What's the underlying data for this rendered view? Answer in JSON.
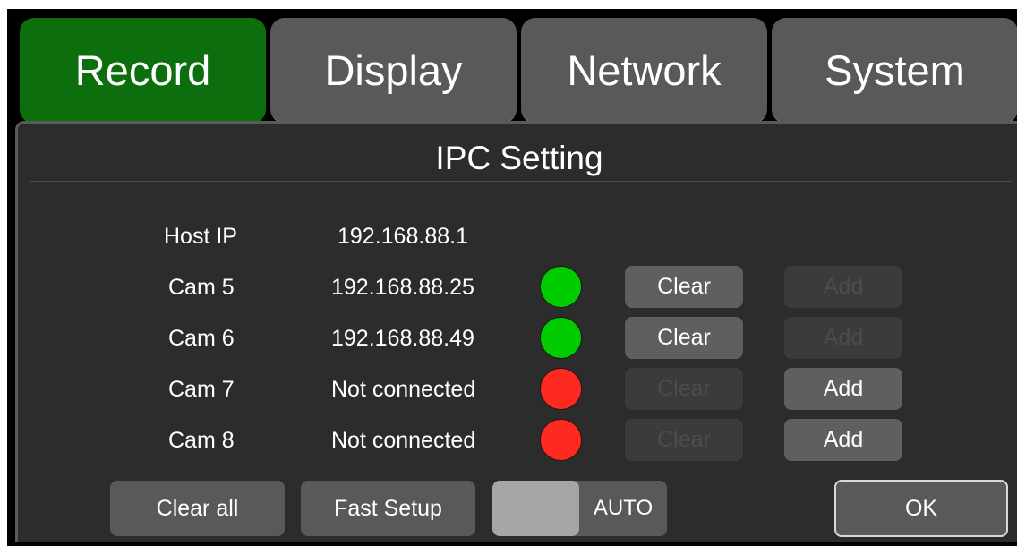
{
  "tabs": [
    {
      "label": "Record",
      "active": true
    },
    {
      "label": "Display",
      "active": false
    },
    {
      "label": "Network",
      "active": false
    },
    {
      "label": "System",
      "active": false
    }
  ],
  "panel": {
    "title": "IPC Setting"
  },
  "host": {
    "label": "Host IP",
    "ip": "192.168.88.1"
  },
  "cameras": [
    {
      "name": "Cam 5",
      "ip": "192.168.88.25",
      "status": "connected",
      "clear": "Clear",
      "add": "Add",
      "clear_enabled": true,
      "add_enabled": false
    },
    {
      "name": "Cam 6",
      "ip": "192.168.88.49",
      "status": "connected",
      "clear": "Clear",
      "add": "Add",
      "clear_enabled": true,
      "add_enabled": false
    },
    {
      "name": "Cam 7",
      "ip": "Not connected",
      "status": "disconnected",
      "clear": "Clear",
      "add": "Add",
      "clear_enabled": false,
      "add_enabled": true
    },
    {
      "name": "Cam 8",
      "ip": "Not connected",
      "status": "disconnected",
      "clear": "Clear",
      "add": "Add",
      "clear_enabled": false,
      "add_enabled": true
    }
  ],
  "footer": {
    "clear_all": "Clear all",
    "fast_setup": "Fast Setup",
    "mode": "AUTO",
    "ok": "OK"
  },
  "colors": {
    "tab_active": "#0d6e0d",
    "tab_inactive": "#595959",
    "status_connected": "#00cc00",
    "status_disconnected": "#ff2a1f"
  }
}
